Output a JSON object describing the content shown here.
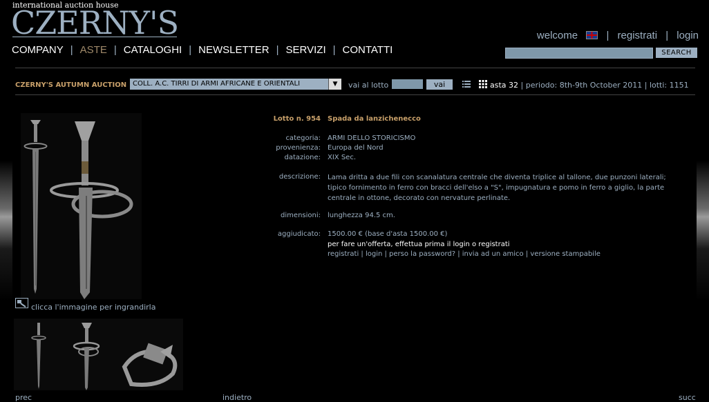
{
  "header": {
    "tagline": "international auction house",
    "logo": "CZERNY'S",
    "welcome": "welcome",
    "registrati": "registrati",
    "login": "login",
    "flag_icon": "uk-flag-icon"
  },
  "nav": {
    "items": [
      "COMPANY",
      "ASTE",
      "CATALOGHI",
      "NEWSLETTER",
      "SERVIZI",
      "CONTATTI"
    ],
    "active": "ASTE"
  },
  "search": {
    "button": "SEARCH",
    "value": ""
  },
  "auction_bar": {
    "name": "CZERNY'S AUTUMN AUCTION",
    "collection": "COLL. A.C. TIRRI DI ARMI AFRICANE E ORIENTALI",
    "vai_al_lotto": "vai al lotto",
    "vai": "vai",
    "asta": "asta 32",
    "periodo": "| periodo: 8th-9th October 2011 | lotti: 1151"
  },
  "lot": {
    "number_label": "Lotto n. 954",
    "title": "Spada da lanzichenecco",
    "categoria_label": "categoria:",
    "categoria": "ARMI DELLO STORICISMO",
    "provenienza_label": "provenienza:",
    "provenienza": "Europa del Nord",
    "datazione_label": "datazione:",
    "datazione": "XIX Sec.",
    "descrizione_label": "descrizione:",
    "descrizione": "Lama dritta a due fili con scanalatura centrale che diventa triplice al tallone, due punzoni laterali; tipico fornimento in ferro con bracci dell'elso a \"S\", impugnatura e pomo in ferro a giglio, la parte centrale in ottone, decorato con nervature perlinate.",
    "dimensioni_label": "dimensioni:",
    "dimensioni": "lunghezza 94.5 cm.",
    "aggiudicato_label": "aggiudicato:",
    "aggiudicato": "1500.00 € (base d'asta 1500.00 €)",
    "offerta_note": "per fare un'offerta, effettua prima il login o registrati",
    "links": "registrati | login | perso la password? | invia ad un amico | versione stampabile"
  },
  "image": {
    "zoom_text": "clicca l'immagine per ingrandirla"
  },
  "footer": {
    "prec": "prec",
    "indietro": "indietro",
    "succ": "succ"
  }
}
